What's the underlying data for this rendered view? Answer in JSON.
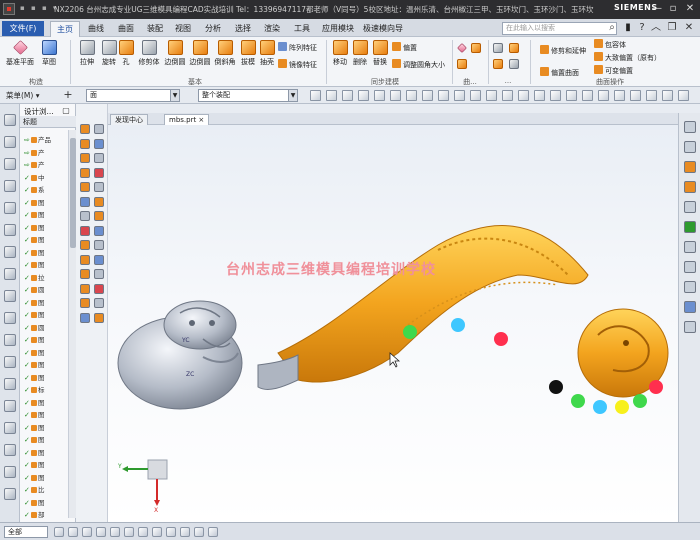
{
  "window": {
    "title": "NX2206 台州志成专业UG三维模具编程CAD实战培训 Tel：13396947117都老师（V同号）5校区地址：温州乐清、台州椒江三甲、玉环坎门、玉环沙门、玉环坎门 - 建模",
    "brand": "SIEMENS",
    "qat_label": "▪ ▪ ▪ ▾"
  },
  "tabs": {
    "file": "文件(F)",
    "items": [
      "主页",
      "曲线",
      "曲面",
      "装配",
      "视图",
      "分析",
      "选择",
      "渲染",
      "工具",
      "应用模块",
      "极速模向导"
    ],
    "search_placeholder": "在此输入以搜索"
  },
  "ribbon": {
    "big_buttons": [
      "基准平面",
      "草图",
      "拉伸",
      "旋转",
      "孔",
      "修剪体",
      "边倒圆",
      "边倒圆",
      "倒斜角",
      "拔模",
      "抽壳",
      "移动",
      "删除",
      "替换"
    ],
    "small_buttons": [
      "阵列特征",
      "镜像特征",
      "偏置",
      "调整圆角大小",
      "修剪和延伸",
      "偏置曲面",
      "包容体",
      "大致偏置（原有）",
      "可变偏置"
    ],
    "groups": [
      "构造",
      "基本",
      "同步建模",
      "曲...",
      "...",
      "曲面操作"
    ]
  },
  "toolbar2": {
    "menu": "菜单(M) ▾",
    "filter": "面",
    "scope": "整个装配"
  },
  "navigator": {
    "title": "设计浏...",
    "column": "标题",
    "rows": [
      {
        "check": false,
        "label": "产品"
      },
      {
        "check": false,
        "label": "产"
      },
      {
        "check": false,
        "label": "产"
      },
      {
        "check": true,
        "label": "中"
      },
      {
        "check": true,
        "label": "系"
      },
      {
        "check": true,
        "label": "图"
      },
      {
        "check": true,
        "label": "图"
      },
      {
        "check": true,
        "label": "图"
      },
      {
        "check": true,
        "label": "图"
      },
      {
        "check": true,
        "label": "图"
      },
      {
        "check": true,
        "label": "图"
      },
      {
        "check": true,
        "label": "拉"
      },
      {
        "check": true,
        "label": "圆"
      },
      {
        "check": true,
        "label": "图"
      },
      {
        "check": true,
        "label": "图"
      },
      {
        "check": true,
        "label": "圆"
      },
      {
        "check": true,
        "label": "图"
      },
      {
        "check": true,
        "label": "图"
      },
      {
        "check": true,
        "label": "图"
      },
      {
        "check": true,
        "label": "图"
      },
      {
        "check": true,
        "label": "标"
      },
      {
        "check": true,
        "label": "图"
      },
      {
        "check": true,
        "label": "图"
      },
      {
        "check": true,
        "label": "图"
      },
      {
        "check": true,
        "label": "图"
      },
      {
        "check": true,
        "label": "图"
      },
      {
        "check": true,
        "label": "图"
      },
      {
        "check": true,
        "label": "图"
      },
      {
        "check": true,
        "label": "比"
      },
      {
        "check": true,
        "label": "图"
      },
      {
        "check": true,
        "label": "部"
      }
    ]
  },
  "graphics": {
    "tabs": [
      "发现中心",
      "mbs.prt ×"
    ],
    "watermark": "台州志成三维模具编程培训学校",
    "triad_y": "Y",
    "triad_x": "X",
    "coord_labels": [
      "YC",
      "ZC"
    ]
  },
  "status": {
    "select_scope": "全部"
  },
  "colors": {
    "model_gold": "#f0a21c",
    "model_silver": "#b8bfca",
    "watermark": "#f0909a",
    "file_button": "#2a5db0"
  }
}
